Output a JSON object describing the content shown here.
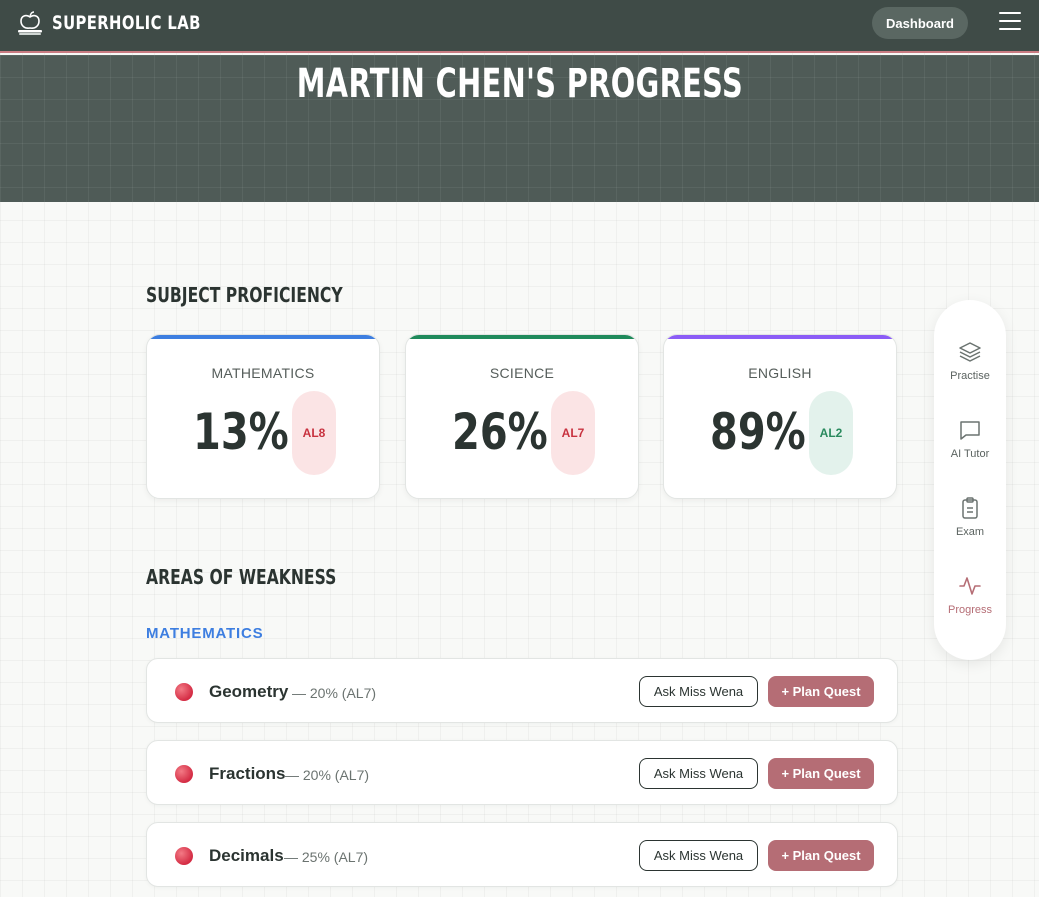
{
  "app": {
    "name": "SUPERHOLIC LAB"
  },
  "header": {
    "dashboard_label": "Dashboard"
  },
  "hero": {
    "title": "MARTIN CHEN'S PROGRESS"
  },
  "proficiency": {
    "heading": "SUBJECT PROFICIENCY",
    "subjects": [
      {
        "name": "MATHEMATICS",
        "percent": "13%",
        "level": "AL8",
        "accent": "#3d7ee0",
        "badge_bg": "#fbe4e5",
        "badge_fg": "#c8323f"
      },
      {
        "name": "SCIENCE",
        "percent": "26%",
        "level": "AL7",
        "accent": "#1f8a5b",
        "badge_bg": "#fbe4e5",
        "badge_fg": "#c8323f"
      },
      {
        "name": "ENGLISH",
        "percent": "89%",
        "level": "AL2",
        "accent": "#8b5cf6",
        "badge_bg": "#e3f2ec",
        "badge_fg": "#2a8a5e"
      }
    ]
  },
  "weakness": {
    "heading": "AREAS OF WEAKNESS",
    "subject": "MATHEMATICS",
    "items": [
      {
        "topic": "Geometry",
        "detail": "— 20% (AL7)",
        "ask_label": "Ask Miss Wena",
        "plan_label": "+ Plan Quest"
      },
      {
        "topic": "Fractions",
        "detail": "— 20% (AL7)",
        "ask_label": "Ask Miss Wena",
        "plan_label": "+ Plan Quest"
      },
      {
        "topic": "Decimals",
        "detail": "— 25% (AL7)",
        "ask_label": "Ask Miss Wena",
        "plan_label": "+ Plan Quest"
      }
    ]
  },
  "side_nav": {
    "items": [
      {
        "label": "Practise",
        "icon": "layers-icon"
      },
      {
        "label": "AI Tutor",
        "icon": "chat-icon"
      },
      {
        "label": "Exam",
        "icon": "clipboard-icon"
      },
      {
        "label": "Progress",
        "icon": "activity-icon",
        "active": true
      }
    ]
  }
}
